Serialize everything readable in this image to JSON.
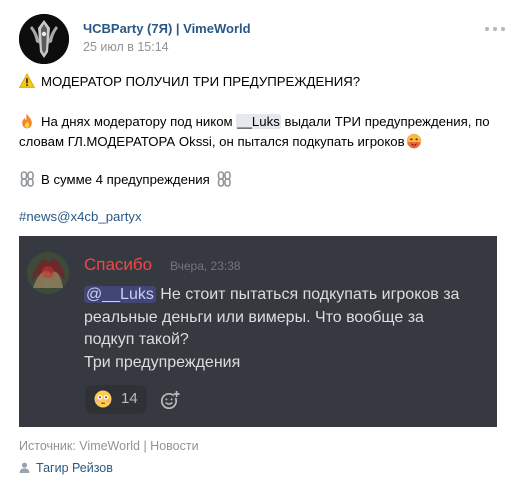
{
  "post": {
    "author": "ЧСВParty (7Я) | VimeWorld",
    "date": "25 июл в 15:14",
    "title_line": "МОДЕРАТОР ПОЛУЧИЛ ТРИ ПРЕДУПРЕЖДЕНИЯ?",
    "body_line1_a": "На днях модератору под ником ",
    "body_line1_mention": "__Luks",
    "body_line1_b": " выдали ТРИ предупреждения, по",
    "body_line2": "словам ГЛ.МОДЕРАТОРА Okssi, он пытался подкупать игроков",
    "summary": "В сумме 4 предупреждения",
    "hashtag": "#news@x4cb_partyx"
  },
  "discord": {
    "username": "Спасибо",
    "timestamp": "Вчера, 23:38",
    "mention": "@__Luks",
    "msg_line1_rest": " Не стоит пытаться подкупать игроков за",
    "msg_line2": "реальные деньги или вимеры. Что вообще за",
    "msg_line3": "подкуп такой?",
    "msg_line4": "Три предупреждения",
    "reaction_count": "14",
    "colors": {
      "background": "#36393f",
      "username": "#f04747",
      "text": "#dcddde"
    }
  },
  "footer": {
    "source": "Источник: VimeWorld | Новости",
    "signer": "Тагир Рейзов"
  },
  "icons": {
    "title": "warning-icon",
    "body": "fire-icon",
    "body_end": "hot-face-icon",
    "summary": "chain-icon",
    "reaction": "flushed-face-icon",
    "add_reaction": "add-reaction-icon",
    "signer": "user-icon",
    "menu": "more-icon"
  },
  "colors": {
    "link": "#2a5885",
    "muted": "#939393"
  }
}
